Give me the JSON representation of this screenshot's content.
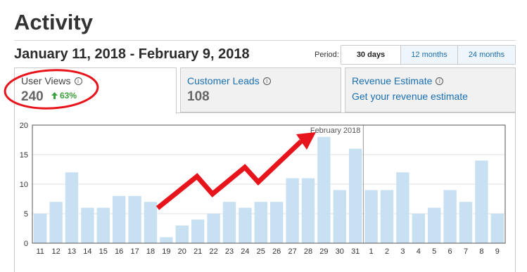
{
  "page": {
    "title": "Activity",
    "date_range": "January 11, 2018 - February 9, 2018"
  },
  "period": {
    "label": "Period:",
    "options": [
      "30 days",
      "12 months",
      "24 months"
    ],
    "selected": "30 days"
  },
  "tabs": [
    {
      "label": "User Views",
      "value": "240",
      "change": "63%"
    },
    {
      "label": "Customer Leads",
      "value": "108"
    },
    {
      "label": "Revenue Estimate",
      "link": "Get your revenue estimate"
    }
  ],
  "colors": {
    "bar": "#c7e0f2",
    "accent_link": "#1a6fb0",
    "positive": "#3ca03c",
    "annotation": "#e8141c"
  },
  "icons": {
    "info": "info-icon",
    "trend": "arrow-up-icon"
  },
  "chart_data": {
    "type": "bar",
    "categories": [
      "11",
      "12",
      "13",
      "14",
      "15",
      "16",
      "17",
      "18",
      "19",
      "20",
      "21",
      "22",
      "23",
      "24",
      "25",
      "26",
      "27",
      "28",
      "29",
      "30",
      "31",
      "1",
      "2",
      "3",
      "4",
      "5",
      "6",
      "7",
      "8",
      "9"
    ],
    "values": [
      5,
      7,
      12,
      6,
      6,
      8,
      8,
      7,
      1,
      3,
      4,
      5,
      7,
      6,
      7,
      7,
      11,
      11,
      18,
      9,
      16,
      9,
      9,
      12,
      5,
      6,
      9,
      7,
      14,
      5
    ],
    "ylim": [
      0,
      20
    ],
    "yticks": [
      0,
      5,
      10,
      15,
      20
    ],
    "grid": true,
    "annotation": "February 2018",
    "annotation_before_category": "1"
  }
}
